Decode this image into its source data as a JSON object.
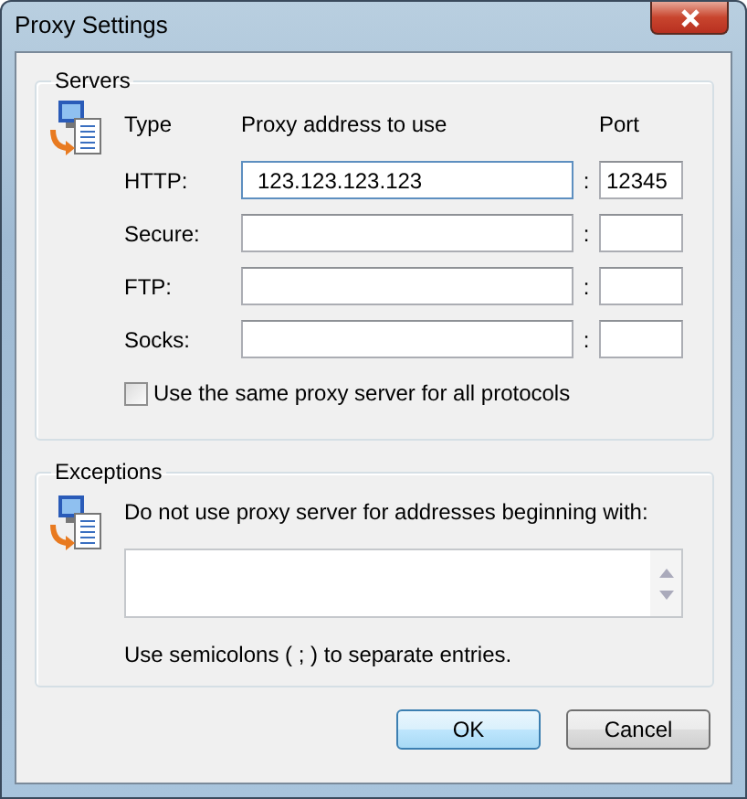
{
  "window": {
    "title": "Proxy Settings"
  },
  "servers": {
    "title": "Servers",
    "headers": {
      "type": "Type",
      "address": "Proxy address to use",
      "port": "Port"
    },
    "rows": [
      {
        "label": "HTTP:",
        "address": "123.123.123.123",
        "port": "12345",
        "separator": ":"
      },
      {
        "label": "Secure:",
        "separator": ":"
      },
      {
        "label": "FTP:",
        "separator": ":"
      },
      {
        "label": "Socks:",
        "separator": ":"
      }
    ],
    "same_proxy": {
      "label": "Use the same proxy server for all protocols",
      "checked": false
    }
  },
  "exceptions": {
    "title": "Exceptions",
    "prompt": "Do not use proxy server for addresses beginning with:",
    "hint": "Use semicolons ( ; ) to separate entries."
  },
  "buttons": [
    {
      "label": "OK",
      "default": true
    },
    {
      "label": "Cancel",
      "default": false
    }
  ]
}
